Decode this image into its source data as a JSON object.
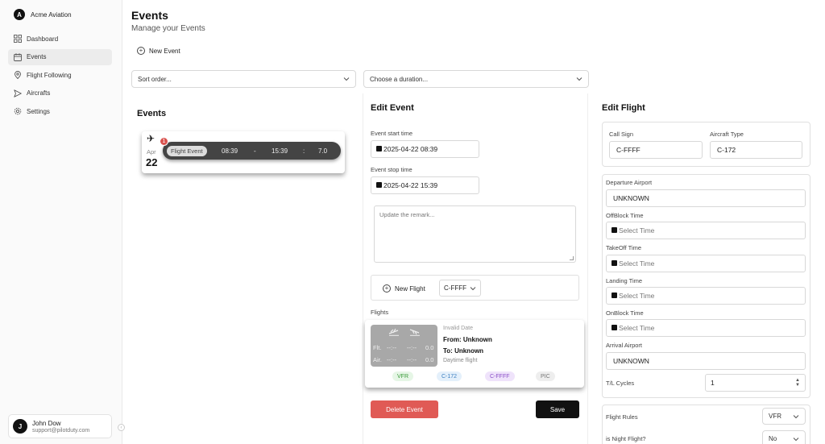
{
  "sidebar": {
    "brand_initial": "A",
    "brand_name": "Acme Aviation",
    "items": [
      {
        "label": "Dashboard",
        "icon": "grid-icon"
      },
      {
        "label": "Events",
        "icon": "calendar-icon"
      },
      {
        "label": "Flight Following",
        "icon": "location-pin-icon"
      },
      {
        "label": "Aircrafts",
        "icon": "send-icon"
      },
      {
        "label": "Settings",
        "icon": "gear-icon"
      }
    ],
    "user": {
      "initial": "J",
      "name": "John Dow",
      "email": "support@pilotduty.com"
    }
  },
  "header": {
    "title": "Events",
    "subtitle": "Manage your Events",
    "new_event_label": "New Event",
    "sort_placeholder": "Sort order...",
    "duration_placeholder": "Choose a duration..."
  },
  "events": {
    "title": "Events",
    "card": {
      "month": "Apr",
      "day": "22",
      "badge": "1",
      "tag": "Flight Event",
      "start": "08:39",
      "dash": "-",
      "end": "15:39",
      "colon": ":",
      "duration": "7.0"
    }
  },
  "edit_event": {
    "title": "Edit Event",
    "start_label": "Event start time",
    "start_value": "2025-04-22 08:39",
    "stop_label": "Event stop time",
    "stop_value": "2025-04-22 15:39",
    "remark_placeholder": "Update the remark...",
    "new_flight_label": "New Flight",
    "aircraft_select": "C-FFFF",
    "flights_label": "Flights",
    "flight_card": {
      "flt_label": "Flt.",
      "air_label": "Air.",
      "flt_from": "--:--",
      "flt_to": "--:--",
      "flt_val": "0.0",
      "air_from": "--:--",
      "air_to": "--:--",
      "air_val": "0.0",
      "date": "Invalid Date",
      "from": "From: Unknown",
      "to": "To: Unknown",
      "daytime": "Daytime flight",
      "chips": [
        "VFR",
        "C-172",
        "C-FFFF",
        "PIC"
      ]
    },
    "delete_label": "Delete Event",
    "save_label": "Save"
  },
  "edit_flight": {
    "title": "Edit Flight",
    "call_sign_label": "Call Sign",
    "call_sign_value": "C-FFFF",
    "aircraft_type_label": "Aircraft Type",
    "aircraft_type_value": "C-172",
    "departure_label": "Departure Airport",
    "departure_value": "UNKNOWN",
    "offblock_label": "OffBlock Time",
    "takeoff_label": "TakeOff Time",
    "landing_label": "Landing Time",
    "onblock_label": "OnBlock Time",
    "time_placeholder": "Select Time",
    "arrival_label": "Arrival Airport",
    "arrival_value": "UNKNOWN",
    "tl_cycles_label": "T/L Cycles",
    "tl_cycles_value": "1",
    "flight_rules_label": "Flight Rules",
    "flight_rules_value": "VFR",
    "night_label": "is Night Flight?",
    "night_value": "No"
  },
  "colors": {
    "delete": "#e05a55",
    "save": "#111111",
    "badge": "#d9534f"
  }
}
